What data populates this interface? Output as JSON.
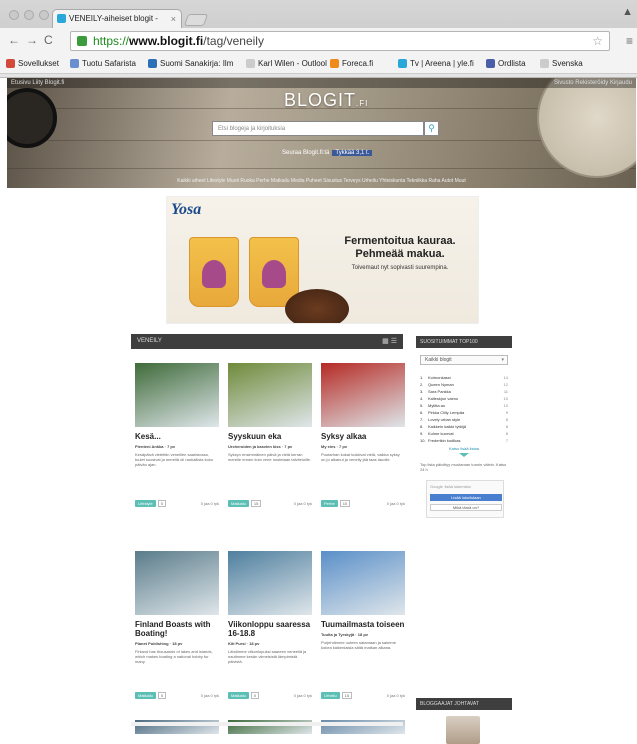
{
  "browser": {
    "tab_title": "VENEILY-aiheiset blogit -",
    "tab_close": "×",
    "url_scheme": "https://",
    "url_host": "www.blogit.fi",
    "url_path": "/tag/veneily",
    "bookmarks": [
      {
        "label": "Sovellukset",
        "color": "#d44a3a"
      },
      {
        "label": "Tuotu Safarista",
        "color": "#6a8fd0"
      },
      {
        "label": "Suomi Sanakirja: Ilm",
        "color": "#2b6fb7"
      },
      {
        "label": "Karl Wilen - Outlool",
        "color": "#cccccc"
      },
      {
        "label": "Foreca.fi",
        "color": "#f08a1a"
      },
      {
        "label": "Tv | Areena | yle.fi",
        "color": "#2aa7d9"
      },
      {
        "label": "Ordlista",
        "color": "#4a5fa8"
      },
      {
        "label": "Svenska",
        "color": "#cccccc"
      }
    ]
  },
  "hero": {
    "logo": "BLOGIT",
    "logo_suffix": ".FI",
    "search_placeholder": "Etsi blogeja ja kirjoituksia",
    "search_icon": "search-icon",
    "follow_text": "Seuraa Blogit.fi:tä",
    "follow_button": "Tykkää 3,1 t.",
    "top_left": "Etusivu   Liity Blogit.fi",
    "top_right": "Sivusto   Rekisteröidy   Kirjaudu",
    "nav": "Kaikki aiheet  Lifestyle  Muoti  Ruoka  Perhe  Matkailu  Media  Puheet  Sisustus  Terveys  Urheilu  Yhteiskunta  Tekniikka  Raha  Autot  Muut"
  },
  "ad": {
    "brand": "Yosa",
    "headline_1": "Fermentoitua kauraa.",
    "headline_2": "Pehmeää makua.",
    "subline": "Toivemaut nyt sopivasti suurempina."
  },
  "category": {
    "title": "VENEILY",
    "view_icon": "grid-list-icon"
  },
  "posts": [
    {
      "title": "Kesä...",
      "author": "Pienteni Ankka · 7 pv",
      "excerpt": "Kesäpäivä vietettiin veneillen saaristossa, tuulet suosivat ja merellä oli rauhallista koko päivän ajan.",
      "category": "Lifestyle",
      "comments": "0",
      "shares": "0 jaa  0 tyk",
      "photo": "#3f6b3a"
    },
    {
      "title": "Syyskuun eka",
      "author": "Urcheroiden ja kasvien kiss · 7 pv",
      "excerpt": "Syksyn ensimmäinen päivä ja vielä kerran merelle ennen kuin vene nostetaan talviteloille.",
      "category": "Matkailu",
      "comments": "15",
      "shares": "0 jaa  0 tyk",
      "photo": "#6f8a3a"
    },
    {
      "title": "Syksy alkaa",
      "author": "My eies · 7 pv",
      "excerpt": "Puutarhan kukat kukkivat vielä, vaikka syksy on jo alkanut ja veneily jää taas tauolle.",
      "category": "Perhe",
      "comments": "10",
      "shares": "0 jaa  0 tyk",
      "photo": "#b52a24"
    },
    {
      "title": "Finland Boasts with Boating!",
      "author": "Planet Publishing · 18 pv",
      "excerpt": "Finland has thousands of lakes and islands, which makes boating a national hobby for many.",
      "category": "Matkailu",
      "comments": "0",
      "shares": "0 jaa  0 tyk",
      "photo": "#5a7c8a"
    },
    {
      "title": "Viikonloppu saaressa 16-18.8",
      "author": "Kiti Pursi · 18 pv",
      "excerpt": "Lähdimme viikonlopuksi saareen veneellä ja nautimme kesän viimeisistä lämpimistä päivistä.",
      "category": "Matkailu",
      "comments": "0",
      "shares": "0 jaa  0 tyk",
      "photo": "#4f7f9f"
    },
    {
      "title": "Tuumailmasta toiseen",
      "author": "Tuulta ja Tyrskyjä · 18 pv",
      "excerpt": "Purjehdimme uuteen satamaan ja saimme kokea kaikenlaisia säitä matkan aikana.",
      "category": "Urheilu",
      "comments": "15",
      "shares": "0 jaa  0 tyk",
      "photo": "#5a8fc8"
    }
  ],
  "sidebar": {
    "head": "SUOSITUIMMAT TOP100",
    "select": "Kaikki blogit",
    "items": [
      {
        "n": "1.",
        "label": "Kolmonkassi",
        "count": "14"
      },
      {
        "n": "2.",
        "label": "Queen Nyman",
        "count": "12"
      },
      {
        "n": "3.",
        "label": "Sara Pankka",
        "count": "11"
      },
      {
        "n": "4.",
        "label": "Kalleskjon vaimo",
        "count": "10"
      },
      {
        "n": "5.",
        "label": "Mylitta ao",
        "count": "10"
      },
      {
        "n": "6.",
        "label": "Pirkka Clilly Lempäa",
        "count": "9"
      },
      {
        "n": "7.",
        "label": "Lovely urban style",
        "count": "8"
      },
      {
        "n": "8.",
        "label": "Kaikkein kaikki tyttöjä",
        "count": "8"
      },
      {
        "n": "9.",
        "label": "Kulme kuorvat",
        "count": "8"
      },
      {
        "n": "10.",
        "label": "Frederikin kodikas",
        "count": "7"
      }
    ],
    "more": "Katso lisää listaa",
    "note": "Top lista päivittyy muutaman tunnin välein. Katso 24 h",
    "google_logo": "Google",
    "google_sub": "lisää lukemisto",
    "google_btn1": "Lisää lukulistaan",
    "google_btn2": "Mikä tämä on?",
    "head2": "BLOGGAAJAT JOHTAVAT"
  }
}
